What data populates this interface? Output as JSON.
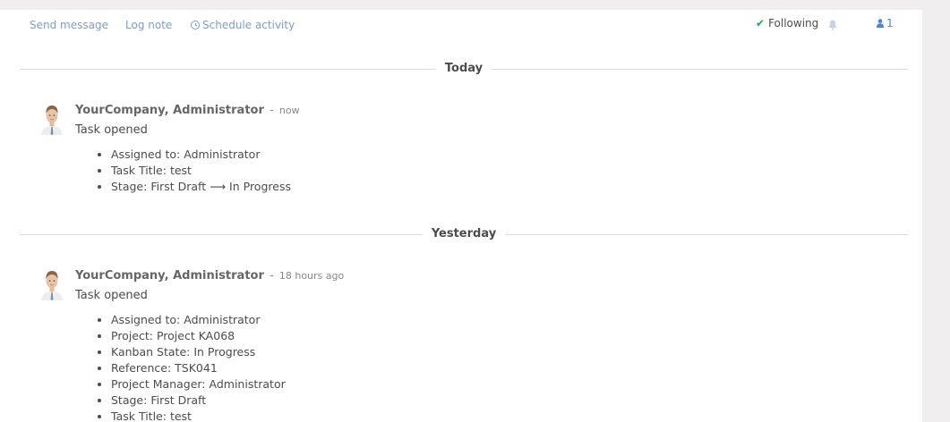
{
  "topbar": {
    "send_message": "Send message",
    "log_note": "Log note",
    "schedule_activity": "Schedule activity",
    "following": "Following",
    "followers_count": "1"
  },
  "groups": [
    {
      "date": "Today",
      "message": {
        "author": "YourCompany, Administrator",
        "separator": "-",
        "time": "now",
        "subject": "Task opened",
        "tracking": [
          {
            "label": "Assigned to:",
            "value": "Administrator"
          },
          {
            "label": "Task Title:",
            "value": "test"
          },
          {
            "label": "Stage:",
            "old_value": "First Draft",
            "arrow": "⟶",
            "new_value": "In Progress"
          }
        ]
      }
    },
    {
      "date": "Yesterday",
      "message": {
        "author": "YourCompany, Administrator",
        "separator": "-",
        "time": "18 hours ago",
        "subject": "Task opened",
        "tracking": [
          {
            "label": "Assigned to:",
            "value": "Administrator"
          },
          {
            "label": "Project:",
            "value": "Project KA068"
          },
          {
            "label": "Kanban State:",
            "value": "In Progress"
          },
          {
            "label": "Reference:",
            "value": "TSK041"
          },
          {
            "label": "Project Manager:",
            "value": "Administrator"
          },
          {
            "label": "Stage:",
            "value": "First Draft"
          },
          {
            "label": "Task Title:",
            "value": "test"
          }
        ]
      }
    }
  ],
  "colors": {
    "link": "#7c9fc6",
    "check": "#28a745",
    "follower_accent": "#4a86d6",
    "text": "#4c4c4c",
    "separator": "#dcdcdc"
  },
  "icons": {
    "schedule": "clock-icon",
    "following": "check-icon",
    "notifications": "bell-icon",
    "followers": "user-icon"
  }
}
